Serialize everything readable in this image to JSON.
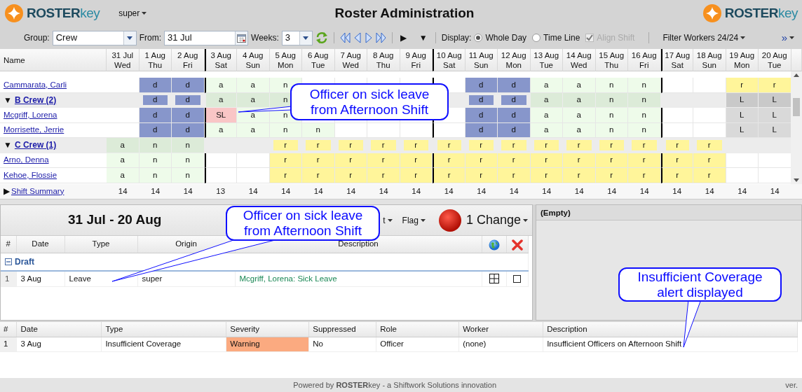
{
  "header": {
    "logo": "**ROSTER**key",
    "user": "super",
    "title": "Roster Administration",
    "logo_right": "**ROSTER**key"
  },
  "toolbar": {
    "group_label": "Group:",
    "group_value": "Crew",
    "from_label": "From:",
    "from_value": "31 Jul",
    "weeks_label": "Weeks:",
    "weeks_value": "3",
    "play": "▶",
    "expand": "▼",
    "display_label": "Display:",
    "display_options": [
      {
        "label": "Whole Day",
        "selected": true
      },
      {
        "label": "Time Line",
        "selected": false
      }
    ],
    "align_shift": {
      "label": "Align Shift",
      "checked": true,
      "disabled": true
    },
    "filter": "Filter Workers 24/24",
    "more": "»"
  },
  "roster": {
    "name_heading": "Name",
    "dates": [
      {
        "date": "31 Jul",
        "day": "Wed",
        "week_start": false
      },
      {
        "date": "1 Aug",
        "day": "Thu",
        "week_start": false
      },
      {
        "date": "2 Aug",
        "day": "Fri",
        "week_start": false
      },
      {
        "date": "3 Aug",
        "day": "Sat",
        "week_start": true
      },
      {
        "date": "4 Aug",
        "day": "Sun",
        "week_start": false
      },
      {
        "date": "5 Aug",
        "day": "Mon",
        "week_start": false
      },
      {
        "date": "6 Aug",
        "day": "Tue",
        "week_start": false
      },
      {
        "date": "7 Aug",
        "day": "Wed",
        "week_start": false
      },
      {
        "date": "8 Aug",
        "day": "Thu",
        "week_start": false
      },
      {
        "date": "9 Aug",
        "day": "Fri",
        "week_start": false
      },
      {
        "date": "10 Aug",
        "day": "Sat",
        "week_start": true
      },
      {
        "date": "11 Aug",
        "day": "Sun",
        "week_start": false
      },
      {
        "date": "12 Aug",
        "day": "Mon",
        "week_start": false
      },
      {
        "date": "13 Aug",
        "day": "Tue",
        "week_start": false
      },
      {
        "date": "14 Aug",
        "day": "Wed",
        "week_start": false
      },
      {
        "date": "15 Aug",
        "day": "Thu",
        "week_start": false
      },
      {
        "date": "16 Aug",
        "day": "Fri",
        "week_start": false
      },
      {
        "date": "17 Aug",
        "day": "Sat",
        "week_start": true
      },
      {
        "date": "18 Aug",
        "day": "Sun",
        "week_start": false
      },
      {
        "date": "19 Aug",
        "day": "Mon",
        "week_start": false
      },
      {
        "date": "20 Aug",
        "day": "Tue",
        "week_start": false
      }
    ],
    "rows": [
      {
        "kind": "worker",
        "name": "Cammarata, Carli",
        "cells": [
          {
            "kind": "empty"
          },
          {
            "code": "d",
            "kind": "day"
          },
          {
            "code": "d",
            "kind": "day"
          },
          {
            "code": "a",
            "kind": "afternoon"
          },
          {
            "code": "a",
            "kind": "afternoon"
          },
          {
            "code": "n",
            "kind": "night"
          },
          {
            "kind": "empty"
          },
          {
            "kind": "empty"
          },
          {
            "kind": "empty"
          },
          {
            "kind": "empty"
          },
          {
            "kind": "empty"
          },
          {
            "code": "d",
            "kind": "day"
          },
          {
            "code": "d",
            "kind": "day"
          },
          {
            "code": "a",
            "kind": "afternoon"
          },
          {
            "code": "a",
            "kind": "afternoon"
          },
          {
            "code": "n",
            "kind": "night"
          },
          {
            "code": "n",
            "kind": "night"
          },
          {
            "kind": "empty"
          },
          {
            "kind": "empty"
          },
          {
            "code": "r",
            "kind": "rest"
          },
          {
            "code": "r",
            "kind": "rest"
          }
        ]
      },
      {
        "kind": "group",
        "toggle": "▼",
        "name": "B Crew (2)",
        "cells": [
          {
            "kind": "empty"
          },
          {
            "code": "d",
            "kind": "day"
          },
          {
            "code": "d",
            "kind": "day"
          },
          {
            "code": "a",
            "kind": "afternoon"
          },
          {
            "code": "a",
            "kind": "afternoon"
          },
          {
            "code": "n",
            "kind": "night"
          },
          {
            "kind": "empty"
          },
          {
            "kind": "empty"
          },
          {
            "kind": "empty"
          },
          {
            "kind": "empty"
          },
          {
            "kind": "empty"
          },
          {
            "code": "d",
            "kind": "day"
          },
          {
            "code": "d",
            "kind": "day"
          },
          {
            "code": "a",
            "kind": "afternoon"
          },
          {
            "code": "a",
            "kind": "afternoon"
          },
          {
            "code": "n",
            "kind": "night"
          },
          {
            "code": "n",
            "kind": "night"
          },
          {
            "kind": "empty"
          },
          {
            "kind": "empty"
          },
          {
            "code": "L",
            "kind": "leave"
          },
          {
            "code": "L",
            "kind": "leave"
          }
        ]
      },
      {
        "kind": "worker",
        "name": "Mcgriff, Lorena",
        "cells": [
          {
            "kind": "empty"
          },
          {
            "code": "d",
            "kind": "day"
          },
          {
            "code": "d",
            "kind": "day"
          },
          {
            "code": "SL",
            "kind": "sick"
          },
          {
            "code": "a",
            "kind": "afternoon"
          },
          {
            "code": "n",
            "kind": "night"
          },
          {
            "kind": "empty"
          },
          {
            "kind": "empty"
          },
          {
            "kind": "empty"
          },
          {
            "kind": "empty"
          },
          {
            "kind": "empty"
          },
          {
            "code": "d",
            "kind": "day"
          },
          {
            "code": "d",
            "kind": "day"
          },
          {
            "code": "a",
            "kind": "afternoon"
          },
          {
            "code": "a",
            "kind": "afternoon"
          },
          {
            "code": "n",
            "kind": "night"
          },
          {
            "code": "n",
            "kind": "night"
          },
          {
            "kind": "empty"
          },
          {
            "kind": "empty"
          },
          {
            "code": "L",
            "kind": "leave"
          },
          {
            "code": "L",
            "kind": "leave"
          }
        ]
      },
      {
        "kind": "worker",
        "name": "Morrisette, Jerrie",
        "cells": [
          {
            "kind": "empty"
          },
          {
            "code": "d",
            "kind": "day"
          },
          {
            "code": "d",
            "kind": "day"
          },
          {
            "code": "a",
            "kind": "afternoon"
          },
          {
            "code": "a",
            "kind": "afternoon"
          },
          {
            "code": "n",
            "kind": "night"
          },
          {
            "code": "n",
            "kind": "night"
          },
          {
            "kind": "empty"
          },
          {
            "kind": "empty"
          },
          {
            "kind": "empty"
          },
          {
            "kind": "empty"
          },
          {
            "code": "d",
            "kind": "day"
          },
          {
            "code": "d",
            "kind": "day"
          },
          {
            "code": "a",
            "kind": "afternoon"
          },
          {
            "code": "a",
            "kind": "afternoon"
          },
          {
            "code": "n",
            "kind": "night"
          },
          {
            "code": "n",
            "kind": "night"
          },
          {
            "kind": "empty"
          },
          {
            "kind": "empty"
          },
          {
            "code": "L",
            "kind": "leave"
          },
          {
            "code": "L",
            "kind": "leave"
          }
        ]
      },
      {
        "kind": "group",
        "toggle": "▼",
        "name": "C Crew (1)",
        "cells": [
          {
            "code": "a",
            "kind": "afternoon"
          },
          {
            "code": "n",
            "kind": "night"
          },
          {
            "code": "n",
            "kind": "night"
          },
          {
            "kind": "empty"
          },
          {
            "kind": "empty"
          },
          {
            "code": "r",
            "kind": "rest"
          },
          {
            "code": "r",
            "kind": "rest"
          },
          {
            "code": "r",
            "kind": "rest"
          },
          {
            "code": "r",
            "kind": "rest"
          },
          {
            "code": "r",
            "kind": "rest"
          },
          {
            "code": "r",
            "kind": "rest"
          },
          {
            "code": "r",
            "kind": "rest"
          },
          {
            "code": "r",
            "kind": "rest"
          },
          {
            "code": "r",
            "kind": "rest"
          },
          {
            "code": "r",
            "kind": "rest"
          },
          {
            "code": "r",
            "kind": "rest"
          },
          {
            "code": "r",
            "kind": "rest"
          },
          {
            "code": "r",
            "kind": "rest"
          },
          {
            "code": "r",
            "kind": "rest"
          },
          {
            "kind": "empty"
          },
          {
            "kind": "empty"
          }
        ]
      },
      {
        "kind": "worker",
        "name": "Arno, Denna",
        "cells": [
          {
            "code": "a",
            "kind": "afternoon"
          },
          {
            "code": "n",
            "kind": "night"
          },
          {
            "code": "n",
            "kind": "night"
          },
          {
            "kind": "empty"
          },
          {
            "kind": "empty"
          },
          {
            "code": "r",
            "kind": "rest"
          },
          {
            "code": "r",
            "kind": "rest"
          },
          {
            "code": "r",
            "kind": "rest"
          },
          {
            "code": "r",
            "kind": "rest"
          },
          {
            "code": "r",
            "kind": "rest"
          },
          {
            "code": "r",
            "kind": "rest"
          },
          {
            "code": "r",
            "kind": "rest"
          },
          {
            "code": "r",
            "kind": "rest"
          },
          {
            "code": "r",
            "kind": "rest"
          },
          {
            "code": "r",
            "kind": "rest"
          },
          {
            "code": "r",
            "kind": "rest"
          },
          {
            "code": "r",
            "kind": "rest"
          },
          {
            "code": "r",
            "kind": "rest"
          },
          {
            "code": "r",
            "kind": "rest"
          },
          {
            "kind": "empty"
          },
          {
            "kind": "empty"
          }
        ]
      },
      {
        "kind": "worker",
        "name": "Kehoe, Flossie",
        "cells": [
          {
            "code": "a",
            "kind": "afternoon"
          },
          {
            "code": "n",
            "kind": "night"
          },
          {
            "code": "n",
            "kind": "night"
          },
          {
            "kind": "empty"
          },
          {
            "kind": "empty"
          },
          {
            "code": "r",
            "kind": "rest"
          },
          {
            "code": "r",
            "kind": "rest"
          },
          {
            "code": "r",
            "kind": "rest"
          },
          {
            "code": "r",
            "kind": "rest"
          },
          {
            "code": "r",
            "kind": "rest"
          },
          {
            "code": "r",
            "kind": "rest"
          },
          {
            "code": "r",
            "kind": "rest"
          },
          {
            "code": "r",
            "kind": "rest"
          },
          {
            "code": "r",
            "kind": "rest"
          },
          {
            "code": "r",
            "kind": "rest"
          },
          {
            "code": "r",
            "kind": "rest"
          },
          {
            "code": "r",
            "kind": "rest"
          },
          {
            "code": "r",
            "kind": "rest"
          },
          {
            "code": "r",
            "kind": "rest"
          },
          {
            "kind": "empty"
          },
          {
            "kind": "empty"
          }
        ]
      }
    ],
    "summary": {
      "toggle": "▶",
      "label": "Shift Summary",
      "totals": [
        "14",
        "14",
        "14",
        "13",
        "14",
        "14",
        "14",
        "14",
        "14",
        "14",
        "14",
        "14",
        "14",
        "14",
        "14",
        "14",
        "14",
        "14",
        "14",
        "14",
        "14"
      ]
    }
  },
  "changes": {
    "title": "31 Jul - 20 Aug",
    "menus": [
      "t",
      "Flag"
    ],
    "change_count": "1 Change",
    "columns": [
      "#",
      "Date",
      "Type",
      "Origin",
      "Description"
    ],
    "groups": [
      {
        "name": "Draft",
        "expanded": true,
        "rows": [
          {
            "number": "1",
            "date": "3 Aug",
            "type": "Leave",
            "origin": "super",
            "description": "Mcgriff, Lorena: Sick Leave",
            "checked": false
          }
        ]
      }
    ]
  },
  "detail": {
    "title": "(Empty)"
  },
  "alerts": {
    "columns": [
      "#",
      "Date",
      "Type",
      "Severity",
      "Suppressed",
      "Role",
      "Worker",
      "Description"
    ],
    "rows": [
      {
        "number": "1",
        "date": "3 Aug",
        "type": "Insufficient Coverage",
        "severity": {
          "text": "Warning",
          "color": "#fbaa80"
        },
        "suppressed": "No",
        "role": "Officer",
        "worker": "(none)",
        "description": "Insufficient Officers on Afternoon Shift"
      }
    ]
  },
  "footer": {
    "before": "Powered by",
    "link": "**ROSTER**key",
    "after": "- a Shiftwork Solutions innovation",
    "version": "ver."
  },
  "callouts": [
    {
      "text": "Officer on sick leave from Afternoon Shift"
    },
    {
      "text": "Officer on sick leave from Afternoon Shift"
    },
    {
      "text": "Insufficient Coverage alert displayed"
    }
  ]
}
